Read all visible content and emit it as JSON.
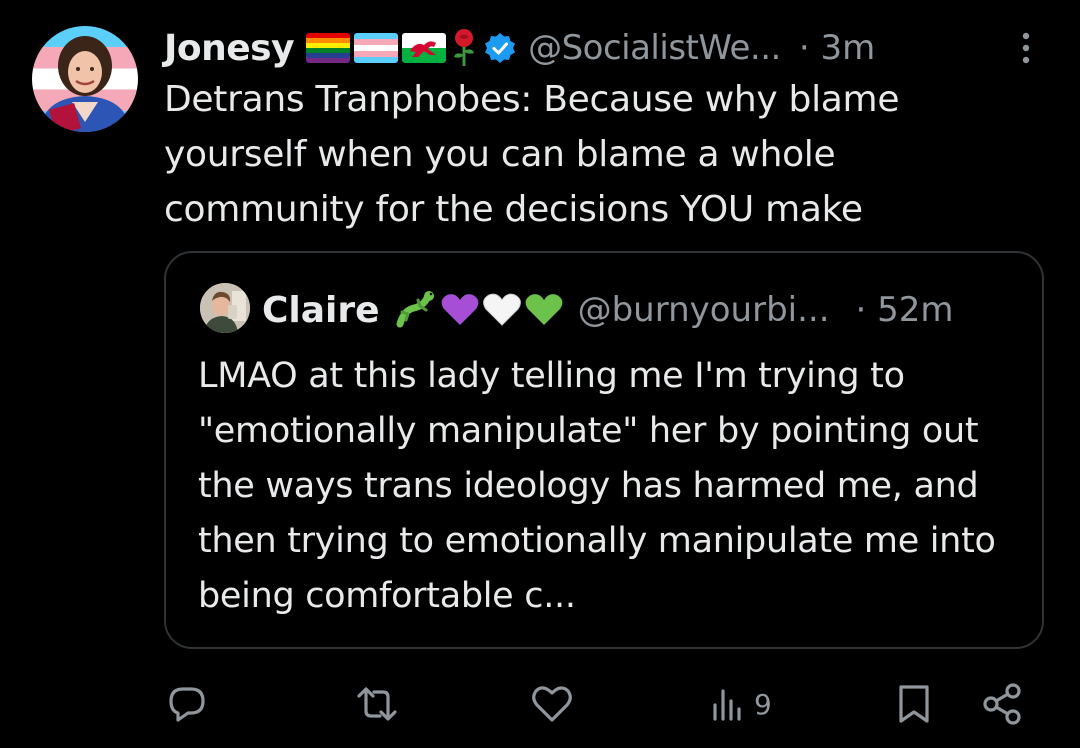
{
  "tweet": {
    "display_name": "Jonesy",
    "name_emoji_icons": [
      "rainbow-flag-icon",
      "trans-flag-icon",
      "wales-flag-icon",
      "rose-icon"
    ],
    "verified_icon": "verified-badge-icon",
    "handle": "@SocialistWe...",
    "time": "· 3m",
    "text": "Detrans Tranphobes: Because why blame yourself when you can blame a whole community for the decisions YOU make"
  },
  "quoted_tweet": {
    "display_name": "Claire",
    "name_emoji_icons": [
      "lizard-icon",
      "purple-heart-icon",
      "white-heart-icon",
      "green-heart-icon"
    ],
    "handle": "@burnyourbi...",
    "time": "· 52m",
    "text": "LMAO at this lady telling me I'm trying to \"emotionally manipulate\" her by pointing out the ways trans ideology has harmed me, and then trying to emotionally manipulate me into being comfortable c..."
  },
  "actions": {
    "reply_icon": "reply-icon",
    "retweet_icon": "retweet-icon",
    "like_icon": "like-icon",
    "views_icon": "views-icon",
    "views_count": "9",
    "bookmark_icon": "bookmark-icon",
    "share_icon": "share-icon"
  },
  "colors": {
    "background": "#000000",
    "text": "#e7e9ea",
    "muted": "#8f969c",
    "border": "#2f3336",
    "verified": "#1d9bf0"
  }
}
